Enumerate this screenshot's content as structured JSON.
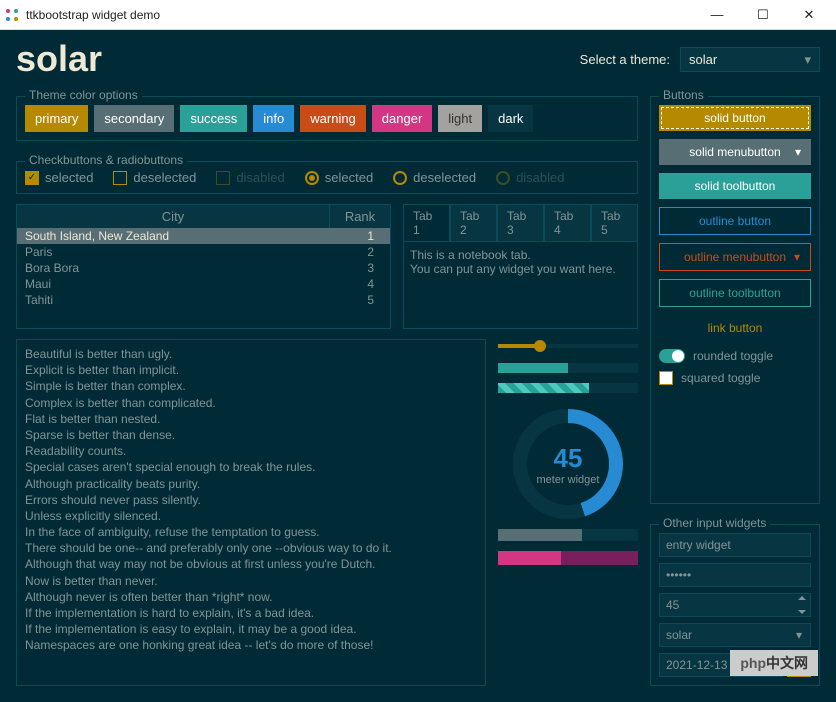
{
  "window": {
    "title": "ttkbootstrap widget demo"
  },
  "header": {
    "theme_name": "solar",
    "select_label": "Select a theme:",
    "select_value": "solar"
  },
  "colors_frame": {
    "title": "Theme color options"
  },
  "swatches": [
    {
      "label": "primary",
      "bg": "#b58900"
    },
    {
      "label": "secondary",
      "bg": "#586e75"
    },
    {
      "label": "success",
      "bg": "#2aa198"
    },
    {
      "label": "info",
      "bg": "#268bd2"
    },
    {
      "label": "warning",
      "bg": "#cb4b16"
    },
    {
      "label": "danger",
      "bg": "#d33682"
    },
    {
      "label": "light",
      "bg": "#a4a29e",
      "fg": "#333"
    },
    {
      "label": "dark",
      "bg": "#073642"
    }
  ],
  "checks_frame": {
    "title": "Checkbuttons & radiobuttons"
  },
  "checks": {
    "cb_sel": "selected",
    "cb_desel": "deselected",
    "cb_dis": "disabled",
    "rb_sel": "selected",
    "rb_desel": "deselected",
    "rb_dis": "disabled"
  },
  "table": {
    "col1": "City",
    "col2": "Rank",
    "rows": [
      {
        "city": "South Island, New Zealand",
        "rank": "1"
      },
      {
        "city": "Paris",
        "rank": "2"
      },
      {
        "city": "Bora Bora",
        "rank": "3"
      },
      {
        "city": "Maui",
        "rank": "4"
      },
      {
        "city": "Tahiti",
        "rank": "5"
      }
    ]
  },
  "notebook": {
    "tabs": [
      "Tab 1",
      "Tab 2",
      "Tab 3",
      "Tab 4",
      "Tab 5"
    ],
    "body_line1": "This is a notebook tab.",
    "body_line2": "You can put any widget you want here."
  },
  "zen": [
    "Beautiful is better than ugly.",
    "Explicit is better than implicit.",
    "Simple is better than complex.",
    "Complex is better than complicated.",
    "Flat is better than nested.",
    "Sparse is better than dense.",
    "Readability counts.",
    "Special cases aren't special enough to break the rules.",
    "Although practicality beats purity.",
    "Errors should never pass silently.",
    "Unless explicitly silenced.",
    "In the face of ambiguity, refuse the temptation to guess.",
    "There should be one-- and preferably only one --obvious way to do it.",
    "Although that way may not be obvious at first unless you're Dutch.",
    "Now is better than never.",
    "Although never is often better than *right* now.",
    "If the implementation is hard to explain, it's a bad idea.",
    "If the implementation is easy to explain, it may be a good idea.",
    "Namespaces are one honking great idea -- let's do more of those!"
  ],
  "meter": {
    "value": "45",
    "label": "meter widget",
    "pbar1_pct": 50,
    "pbar2_pct": 65
  },
  "buttons_frame": {
    "title": "Buttons"
  },
  "buttons": {
    "solid": "solid button",
    "menu": "solid menubutton",
    "tool": "solid toolbutton",
    "outline": "outline button",
    "outmenu": "outline menubutton",
    "outtool": "outline toolbutton",
    "link": "link button"
  },
  "toggles": {
    "round": "rounded toggle",
    "square": "squared toggle"
  },
  "inputs_frame": {
    "title": "Other input widgets"
  },
  "inputs": {
    "entry": "entry widget",
    "password": "••••••",
    "spin": "45",
    "combo": "solar",
    "date": "2021-12-13"
  },
  "watermark": {
    "a": "php",
    "b": "中文网"
  }
}
